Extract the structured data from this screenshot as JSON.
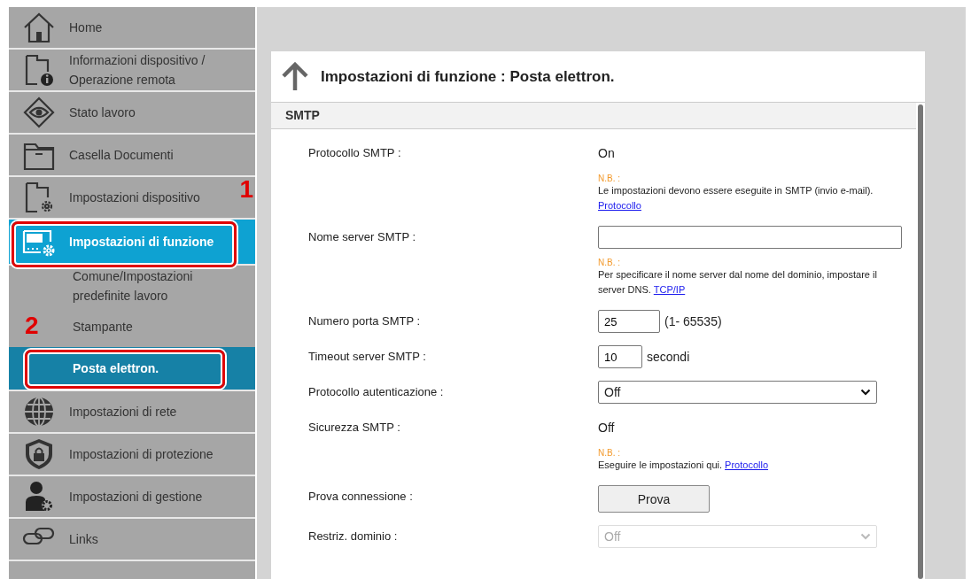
{
  "sidebar": {
    "items": [
      {
        "kind": "home",
        "label": "Home",
        "selected": false,
        "highlighted": false
      },
      {
        "kind": "device-info",
        "label": "Informazioni dispositivo / Operazione remota",
        "selected": false,
        "highlighted": false
      },
      {
        "kind": "job-status",
        "label": "Stato lavoro",
        "selected": false,
        "highlighted": false
      },
      {
        "kind": "document-box",
        "label": "Casella Documenti",
        "selected": false,
        "highlighted": false
      },
      {
        "kind": "device-settings",
        "label": "Impostazioni dispositivo",
        "selected": false,
        "highlighted": false,
        "callout": "1"
      },
      {
        "kind": "function-settings",
        "label": "Impostazioni di funzione",
        "selected": true,
        "highlighted": true,
        "children": [
          {
            "label": "Comune/Impostazioni predefinite lavoro",
            "selected": false,
            "highlighted": false
          },
          {
            "label": "Stampante",
            "selected": false,
            "highlighted": false,
            "callout": "2"
          },
          {
            "label": "Posta elettron.",
            "selected": true,
            "highlighted": true
          }
        ]
      },
      {
        "kind": "network",
        "label": "Impostazioni di rete",
        "selected": false,
        "highlighted": false
      },
      {
        "kind": "security",
        "label": "Impostazioni di protezione",
        "selected": false,
        "highlighted": false
      },
      {
        "kind": "management",
        "label": "Impostazioni di gestione",
        "selected": false,
        "highlighted": false
      },
      {
        "kind": "links",
        "label": "Links",
        "selected": false,
        "highlighted": false
      }
    ]
  },
  "panel": {
    "title": "Impostazioni di funzione : Posta elettron.",
    "section": "SMTP",
    "rows": [
      {
        "label": "Protocollo SMTP :",
        "kind": "text",
        "value": "On",
        "note": {
          "heading": "N.B. :",
          "text": "Le impostazioni devono essere eseguite in SMTP (invio e-mail).",
          "link": "Protocollo",
          "link_newline": true
        }
      },
      {
        "label": "Nome server SMTP :",
        "kind": "input",
        "note": {
          "heading": "N.B. :",
          "text": "Per specificare il nome server dal nome del dominio, impostare il server DNS.",
          "link": "TCP/IP",
          "link_newline": false
        }
      },
      {
        "label": "Numero porta SMTP :",
        "kind": "input",
        "value": "25",
        "suffix": "(1- 65535)"
      },
      {
        "label": "Timeout server SMTP :",
        "kind": "input",
        "value": "10",
        "suffix": "secondi"
      },
      {
        "label": "Protocollo autenticazione :",
        "kind": "select",
        "value": "Off",
        "disabled": false
      },
      {
        "label": "Sicurezza SMTP :",
        "kind": "text",
        "value": "Off",
        "note": {
          "heading": "N.B. :",
          "text": "Eseguire le impostazioni qui.",
          "link": "Protocollo",
          "link_newline": false
        }
      },
      {
        "label": "Prova connessione :",
        "kind": "button",
        "value": "Prova"
      },
      {
        "label": "Restriz. dominio :",
        "kind": "select",
        "value": "Off",
        "disabled": true
      }
    ]
  }
}
